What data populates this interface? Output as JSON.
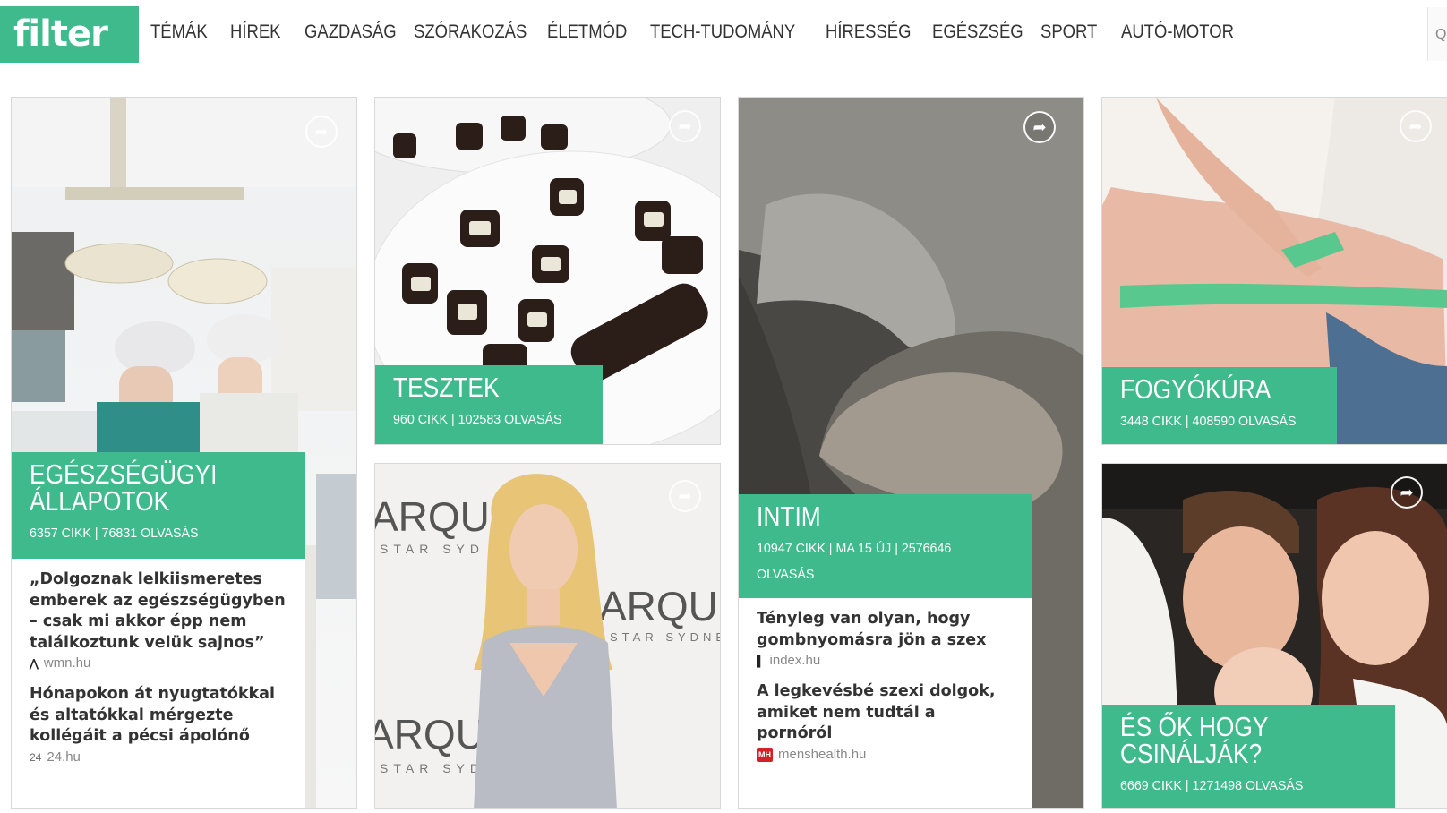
{
  "brand": {
    "logo": "filter",
    "accent": "#3fba8c"
  },
  "nav": [
    "TÉMÁK",
    "HÍREK",
    "GAZDASÁG",
    "SZÓRAKOZÁS",
    "ÉLETMÓD",
    "TECH-TUDOMÁNY",
    "HÍRESSÉG",
    "EGÉSZSÉG",
    "SPORT",
    "AUTÓ-MOTOR"
  ],
  "header_edge_glyph": "Q",
  "cards": {
    "egeszsegugyi": {
      "title_line1": "EGÉSZSÉGÜGYI",
      "title_line2": "ÁLLAPOTOK",
      "stats": "6357 CIKK | 76831 OLVASÁS",
      "articles": [
        {
          "title": "„Dolgoznak lelkiismeretes emberek az egészségügyben – csak mi akkor épp nem találkoztunk velük sajnos”",
          "source": "wmn.hu",
          "source_icon": "wmn-logo-icon"
        },
        {
          "title": "Hónapokon át nyugtatókkal és altatókkal mérgezte kollégáit a pécsi ápolónő",
          "source": "24.hu",
          "source_icon": "24-logo-icon"
        }
      ]
    },
    "tesztek": {
      "title": "TESZTEK",
      "stats": "960 CIKK | 102583 OLVASÁS"
    },
    "intim": {
      "title": "INTIM",
      "stats_line1": "10947 CIKK | MA 15 ÚJ | 2576646",
      "stats_line2": "OLVASÁS",
      "articles": [
        {
          "title": "Tényleg van olyan, hogy gombnyomásra jön a szex",
          "source": "index.hu",
          "source_icon": "index-logo-icon"
        },
        {
          "title": "A legkevésbé szexi dolgok, amiket nem tudtál a pornóról",
          "source": "menshealth.hu",
          "source_icon": "menshealth-logo-icon"
        }
      ]
    },
    "fogyokura": {
      "title": "FOGYÓKÚRA",
      "stats": "3448 CIKK | 408590 OLVASÁS"
    },
    "celebrity": {
      "photo_text_1": "ARQUE",
      "photo_text_2": "STAR SYDNE"
    },
    "es_ok": {
      "title_line1": "ÉS ŐK HOGY",
      "title_line2": "CSINÁLJÁK?",
      "stats": "6669 CIKK | 1271498 OLVASÁS"
    }
  },
  "icons": {
    "share": "share-arrow-icon",
    "share_glyph": "➦"
  }
}
